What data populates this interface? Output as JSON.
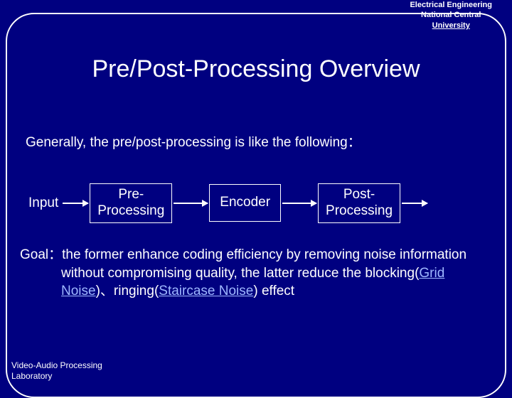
{
  "header": {
    "line1": "Electrical Engineering",
    "line2": "National Central",
    "line3": "University"
  },
  "title": "Pre/Post-Processing Overview",
  "intro": "Generally, the pre/post-processing is like the following：",
  "diagram": {
    "input": "Input",
    "pre1": "Pre-",
    "pre2": "Processing",
    "encoder": "Encoder",
    "post1": "Post-",
    "post2": "Processing"
  },
  "goal": {
    "label": "Goal：",
    "part1": "the former enhance coding efficiency by removing noise information without compromising quality, the latter reduce the blocking(",
    "link1": "Grid Noise",
    "part2": ")、ringing(",
    "link2": "Staircase Noise",
    "part3": ") effect"
  },
  "footer": {
    "line1": "Video-Audio Processing",
    "line2": "Laboratory"
  }
}
